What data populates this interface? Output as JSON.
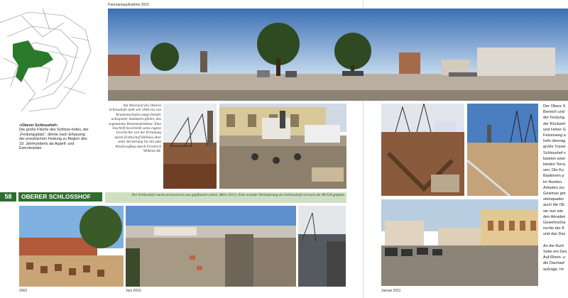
{
  "header": {
    "title": "Panoramaaufnahme 2010"
  },
  "map": {
    "caption_title": "»Oberer Schlosshof«",
    "caption_body": "Die große Fläche des Schloss-hofes, der „Festungsplatz“, diente nach Erbauung der preußischen Festung zu Beginn des 19. Jahrhunderts als Appell- und Exerzierplatz."
  },
  "captions": {
    "brunnen": "Am Westrand des Oberen Schlosshofs steht seit 1844 ein von Brunnenschalen umge-bender achtspitzer Sandstein-pfeiler, das sogenannte Brunnendenkmal. Eine Inschrift beschreibt seine eigene Geschichte von der Erbauung durch Erzbischof Hillinus über seine Zerstörung bis hin zum Wiederaufbau durch Friedrich Wilhelm III.",
    "bottom": "Der Schlosshof wurde provisorisch neu gepflastert (oben, März 2011). Eine erneute Veränderung des Schlosshofs ist nach der BUGA geplant."
  },
  "section": {
    "page_number": "58",
    "title": "OBERER SCHLOSSHOF"
  },
  "right_text": [
    "Der Obere S",
    "Bereich und",
    "der Festung.",
    "der Rückseit",
    "und Hoher G",
    "Felsenweg a",
    "hofs überrag",
    "große Traver",
    "Schlosshof v",
    "bastion sowi",
    "beiden Terra",
    "sen. Die Ku",
    "Bastionen p",
    "im Norden.",
    "Arkaden zur",
    "Gesimse get",
    "steinquader",
    "auch die Ob",
    "sie nun wie",
    "den Arkaden",
    "Gewehrscha",
    "rechts der K",
    "und das Dac",
    "",
    "An die Kurti",
    "Seite ein Ges",
    "Auf Rhein- u",
    "die Dachauf",
    "aufzüge. Im"
  ],
  "dates": {
    "d2003": "2003",
    "juni2010": "Juni 2010",
    "januar2011": "Januar 2011"
  }
}
